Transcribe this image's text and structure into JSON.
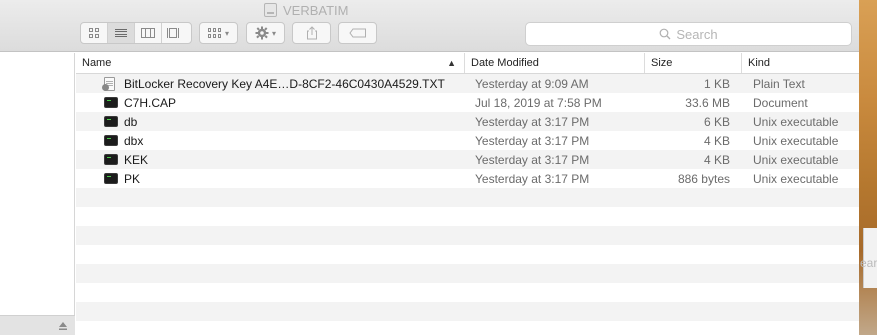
{
  "window": {
    "title": "VERBATIM"
  },
  "toolbar": {
    "search_placeholder": "Search"
  },
  "table": {
    "columns": [
      "Name",
      "Date Modified",
      "Size",
      "Kind"
    ],
    "rows": [
      {
        "name": "BitLocker Recovery Key A4E…D-8CF2-46C0430A4529.TXT",
        "date": "Yesterday at 9:09 AM",
        "size": "1 KB",
        "kind": "Plain Text",
        "icon": "text-file-icon"
      },
      {
        "name": "C7H.CAP",
        "date": "Jul 18, 2019 at 7:58 PM",
        "size": "33.6 MB",
        "kind": "Document",
        "icon": "document-icon"
      },
      {
        "name": "db",
        "date": "Yesterday at 3:17 PM",
        "size": "6 KB",
        "kind": "Unix executable",
        "icon": "executable-icon"
      },
      {
        "name": "dbx",
        "date": "Yesterday at 3:17 PM",
        "size": "4 KB",
        "kind": "Unix executable",
        "icon": "executable-icon"
      },
      {
        "name": "KEK",
        "date": "Yesterday at 3:17 PM",
        "size": "4 KB",
        "kind": "Unix executable",
        "icon": "executable-icon"
      },
      {
        "name": "PK",
        "date": "Yesterday at 3:17 PM",
        "size": "886 bytes",
        "kind": "Unix executable",
        "icon": "executable-icon"
      }
    ]
  },
  "desktop": {
    "partial_text": "ear"
  },
  "colors": {
    "row_stripe": "#f3f3f3",
    "toolbar_bg": "#e4e4e4",
    "secondary_text": "#6b6b6b"
  }
}
